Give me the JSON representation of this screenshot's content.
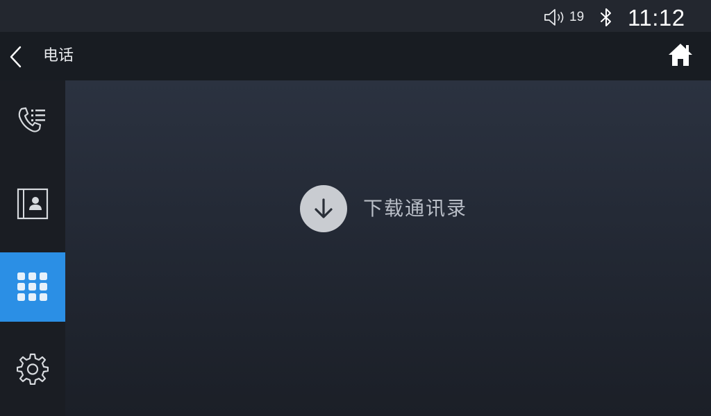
{
  "status_bar": {
    "volume_icon": "speaker-icon",
    "volume_level": "19",
    "bluetooth_icon": "bluetooth-icon",
    "time": "11:12"
  },
  "header": {
    "back_icon": "chevron-left-icon",
    "title": "电话",
    "home_icon": "home-icon"
  },
  "sidebar": {
    "items": [
      {
        "id": "call-log",
        "icon": "call-log-icon",
        "active": false
      },
      {
        "id": "contacts",
        "icon": "contacts-icon",
        "active": false
      },
      {
        "id": "dialpad",
        "icon": "dialpad-icon",
        "active": true
      },
      {
        "id": "settings",
        "icon": "gear-icon",
        "active": false
      }
    ]
  },
  "main": {
    "download_icon": "download-arrow-icon",
    "download_label": "下载通讯录"
  },
  "colors": {
    "status_bar_bg": "#23272f",
    "title_bar_bg": "#181c22",
    "sidebar_bg": "#1a1d23",
    "active_accent": "#2b8fe5",
    "content_bg_top": "#2b3240",
    "content_bg_bottom": "#1b1f27",
    "download_circle": "#c9ccd1",
    "download_text": "#b9bec7"
  }
}
